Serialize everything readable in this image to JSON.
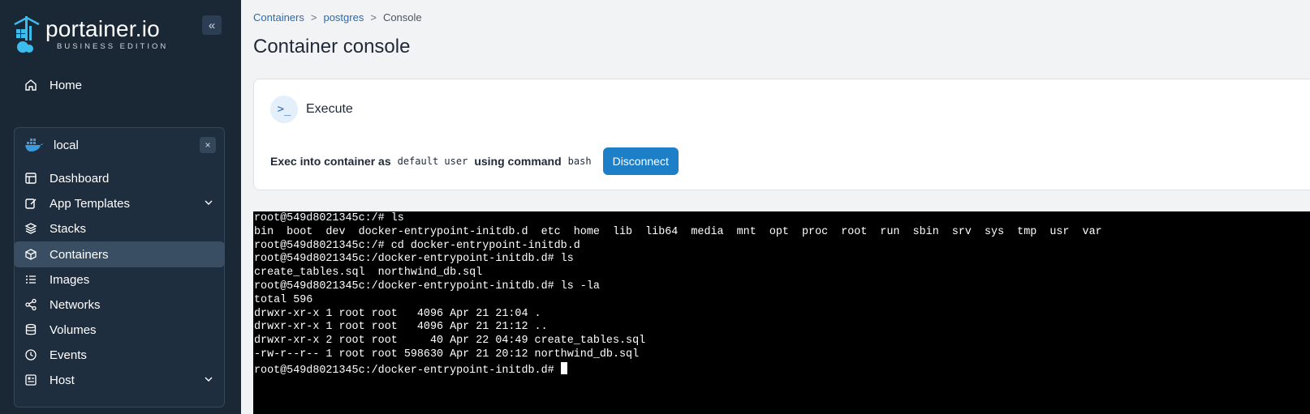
{
  "sidebar": {
    "logo": {
      "main": "portainer.io",
      "sub": "BUSINESS EDITION"
    },
    "collapse_icon": "double-chevron-left",
    "home_label": "Home",
    "environment": {
      "name": "local",
      "close_label": "×",
      "items": [
        {
          "label": "Dashboard",
          "icon": "dashboard-icon"
        },
        {
          "label": "App Templates",
          "icon": "edit-icon",
          "expandable": true
        },
        {
          "label": "Stacks",
          "icon": "layers-icon"
        },
        {
          "label": "Containers",
          "icon": "box-icon",
          "active": true
        },
        {
          "label": "Images",
          "icon": "list-icon"
        },
        {
          "label": "Networks",
          "icon": "share-icon"
        },
        {
          "label": "Volumes",
          "icon": "database-icon"
        },
        {
          "label": "Events",
          "icon": "clock-icon"
        },
        {
          "label": "Host",
          "icon": "host-icon",
          "expandable": true
        }
      ]
    }
  },
  "breadcrumb": {
    "first": "Containers",
    "second": "postgres",
    "third": "Console",
    "sep": ">"
  },
  "page_title": "Container console",
  "card": {
    "title": "Execute",
    "exec_prefix": "Exec into container as",
    "user": "default user",
    "using_command": "using command",
    "command": "bash",
    "disconnect_label": "Disconnect"
  },
  "terminal": {
    "lines": [
      "root@549d8021345c:/# ls",
      "bin  boot  dev  docker-entrypoint-initdb.d  etc  home  lib  lib64  media  mnt  opt  proc  root  run  sbin  srv  sys  tmp  usr  var",
      "root@549d8021345c:/# cd docker-entrypoint-initdb.d",
      "root@549d8021345c:/docker-entrypoint-initdb.d# ls",
      "create_tables.sql  northwind_db.sql",
      "root@549d8021345c:/docker-entrypoint-initdb.d# ls -la",
      "total 596",
      "drwxr-xr-x 1 root root   4096 Apr 21 21:04 .",
      "drwxr-xr-x 1 root root   4096 Apr 21 21:12 ..",
      "drwxr-xr-x 2 root root     40 Apr 22 04:49 create_tables.sql",
      "-rw-r--r-- 1 root root 598630 Apr 21 20:12 northwind_db.sql"
    ],
    "prompt": "root@549d8021345c:/docker-entrypoint-initdb.d# "
  },
  "colors": {
    "sidebar_bg": "#1a2735",
    "accent": "#1c7fc8",
    "terminal_bg": "#000000"
  }
}
